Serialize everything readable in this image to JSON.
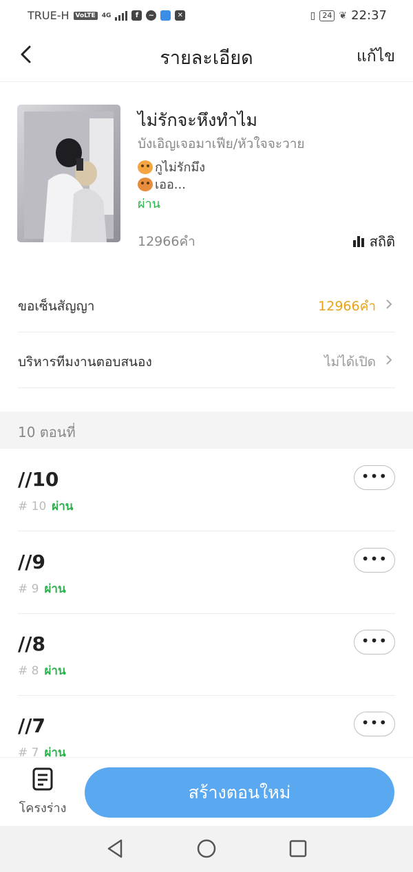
{
  "status_bar": {
    "carrier": "TRUE-H",
    "volte": "VoLTE",
    "network": "4G",
    "battery": "24",
    "time": "22:37"
  },
  "header": {
    "title": "รายละเอียด",
    "edit_label": "แก้ไข"
  },
  "book": {
    "title": "ไม่รักจะหึงทำไม",
    "subtitle": "บังเอิญเจอมาเฟีย/หัวใจจะวาย",
    "line1": "กูไม่รักมึง",
    "line2": "เออ...",
    "status": "ผ่าน",
    "word_count": "12966คำ",
    "stats_label": "สถิติ"
  },
  "rows": [
    {
      "label": "ขอเซ็นสัญญา",
      "value": "12966คำ",
      "value_color": "#e8a317"
    },
    {
      "label": "บริหารทีมงานตอบสนอง",
      "value": "ไม่ได้เปิด",
      "value_color": "#999999"
    }
  ],
  "section": {
    "label": "10 ตอนที่"
  },
  "chapters": [
    {
      "title": "//10",
      "num": "# 10",
      "status": "ผ่าน"
    },
    {
      "title": "//9",
      "num": "# 9",
      "status": "ผ่าน"
    },
    {
      "title": "//8",
      "num": "# 8",
      "status": "ผ่าน"
    },
    {
      "title": "//7",
      "num": "# 7",
      "status": "ผ่าน"
    }
  ],
  "more_label": "•••",
  "bottom": {
    "draft_label": "โครงร่าง",
    "create_label": "สร้างตอนใหม่"
  },
  "colors": {
    "accent_blue": "#5aa8ef",
    "status_green": "#2bb24c",
    "warning_orange": "#e8a317"
  }
}
